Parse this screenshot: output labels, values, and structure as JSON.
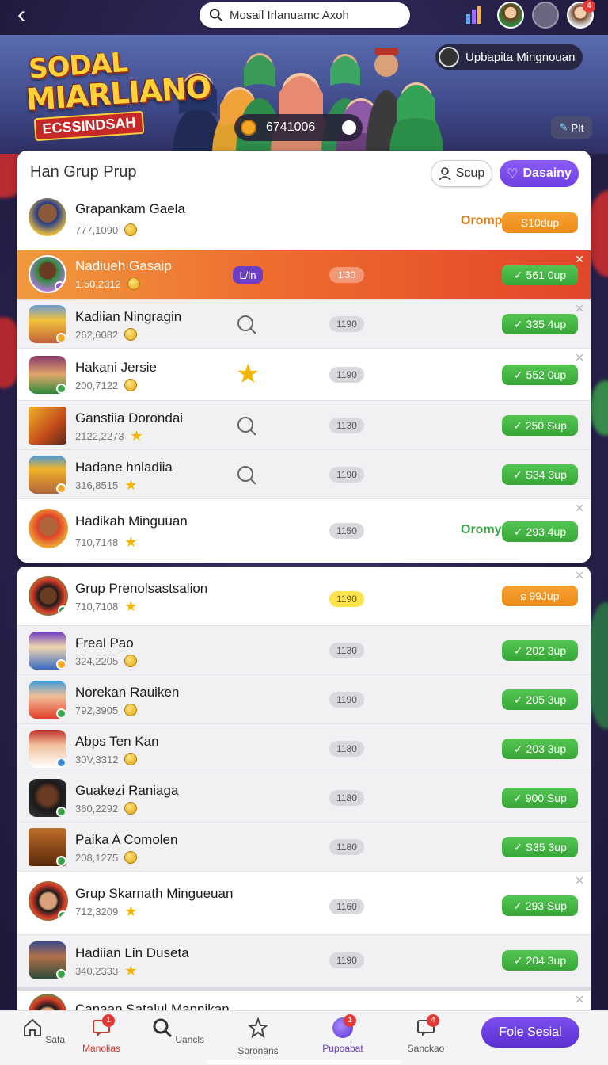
{
  "search": {
    "value": "Mosail Irlanuamc Axoh"
  },
  "top_icons": {
    "notification_count": "4"
  },
  "banner": {
    "logo_line1": "SODAL",
    "logo_line2": "MIARLIANO",
    "logo_line3": "ECSSINDSAH",
    "coins": "6741006",
    "weekly_label": "Upbapita Mingnouan",
    "small_pill": "PIt"
  },
  "panel": {
    "title": "Han Grup Prup",
    "scup_label": "Scup",
    "daily_label": "Dasainy"
  },
  "rows": [
    {
      "name": "Grapankam Gaela",
      "score": "777,1090",
      "tag": "Oromp",
      "reward": "S10dup",
      "style": "orange"
    },
    {
      "name": "Nadiueh Gasaip",
      "score": "1.50,2312",
      "rank": "L/in",
      "pill": "1'30",
      "reward": "561 0up"
    },
    {
      "name": "Kadiian Ningragin",
      "score": "262,6082",
      "pill": "1190",
      "reward": "335 4up"
    },
    {
      "name": "Hakani Jersie",
      "score": "200,7122",
      "pill": "1190",
      "reward": "552 0up"
    },
    {
      "name": "Ganstiia Dorondai",
      "score": "2122,2273",
      "pill": "1130",
      "reward": "250 Sup"
    },
    {
      "name": "Hadane hnladiia",
      "score": "316,8515",
      "pill": "1190",
      "reward": "S34 3up"
    },
    {
      "name": "Hadikah Minguuan",
      "score": "710,7148",
      "pill": "1150",
      "tag": "Oromy",
      "reward": "293 4up"
    }
  ],
  "rows2": [
    {
      "name": "Grup Prenolsastsalion",
      "score": "710,7108",
      "pill": "1190",
      "reward": "ɕ 99Jup",
      "style": "orange"
    },
    {
      "name": "Freal Pao",
      "score": "324,2205",
      "pill": "1130",
      "reward": "202 3up"
    },
    {
      "name": "Norekan Rauiken",
      "score": "792,3905",
      "pill": "1190",
      "reward": "205 3up"
    },
    {
      "name": "Abps Ten Kan",
      "score": "30V,3312",
      "pill": "1180",
      "reward": "203 3up"
    },
    {
      "name": "Guakezi Raniaga",
      "score": "360,2292",
      "pill": "1180",
      "reward": "900 Sup"
    },
    {
      "name": "Paika A Comolen",
      "score": "208,1275",
      "pill": "1180",
      "reward": "S35 3up"
    },
    {
      "name": "Grup Skarnath Mingueuan",
      "score": "712,3209",
      "pill": "1160",
      "reward": "293 Sup"
    },
    {
      "name": "Hadiian Lin Duseta",
      "score": "340,2333",
      "pill": "1190",
      "reward": "204 3up"
    },
    {
      "name": "Canaan Satalul Mannikan"
    }
  ],
  "nav": {
    "items": [
      "Sata",
      "Manolias",
      "Uancls",
      "Soronans",
      "Pupoabat",
      "Sanckao"
    ],
    "badge_manolias": "1",
    "badge_pupoabat": "1",
    "badge_sanckao": "4",
    "cta": "Fole Sesial"
  }
}
